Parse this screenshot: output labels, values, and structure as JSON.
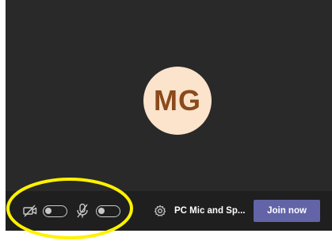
{
  "preview": {
    "avatar_initials": "MG",
    "avatar_color": "#fbe3cc",
    "initials_color": "#8a4a1c"
  },
  "toolbar": {
    "camera_icon": "camera-off-icon",
    "camera_toggle_on": false,
    "mic_icon": "mic-off-icon",
    "mic_toggle_on": false,
    "settings_icon": "gear-icon",
    "device_label": "PC Mic and Sp...",
    "join_label": "Join now",
    "join_color": "#6264a7"
  },
  "annotation": {
    "highlight_color": "#fff200"
  }
}
